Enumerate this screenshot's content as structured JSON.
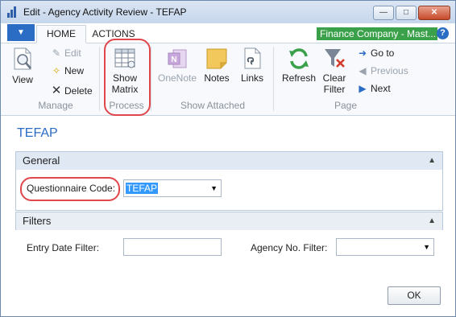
{
  "window": {
    "title": "Edit - Agency Activity Review - TEFAP"
  },
  "ribbon": {
    "tabs": [
      {
        "label": "HOME"
      },
      {
        "label": "ACTIONS"
      }
    ],
    "company": "Finance Company - Mast...",
    "help": "?",
    "groups": {
      "manage": {
        "label": "Manage",
        "view": "View",
        "edit": "Edit",
        "new": "New",
        "delete": "Delete"
      },
      "process": {
        "label": "Process",
        "show_matrix_line1": "Show",
        "show_matrix_line2": "Matrix"
      },
      "show_attached": {
        "label": "Show Attached",
        "onenote": "OneNote",
        "notes": "Notes",
        "links": "Links"
      },
      "page": {
        "label": "Page",
        "refresh": "Refresh",
        "clear_filter_line1": "Clear",
        "clear_filter_line2": "Filter",
        "go_to": "Go to",
        "previous": "Previous",
        "next": "Next"
      }
    }
  },
  "page_title": "TEFAP",
  "general": {
    "header": "General",
    "questionnaire_label": "Questionnaire Code:",
    "questionnaire_value": "TEFAP"
  },
  "filters": {
    "header": "Filters",
    "entry_date_label": "Entry Date Filter:",
    "agency_no_label": "Agency No. Filter:"
  },
  "footer": {
    "ok": "OK"
  },
  "colors": {
    "accent": "#2b6cc4",
    "company": "#3aa14a",
    "highlight": "#e0464b"
  }
}
